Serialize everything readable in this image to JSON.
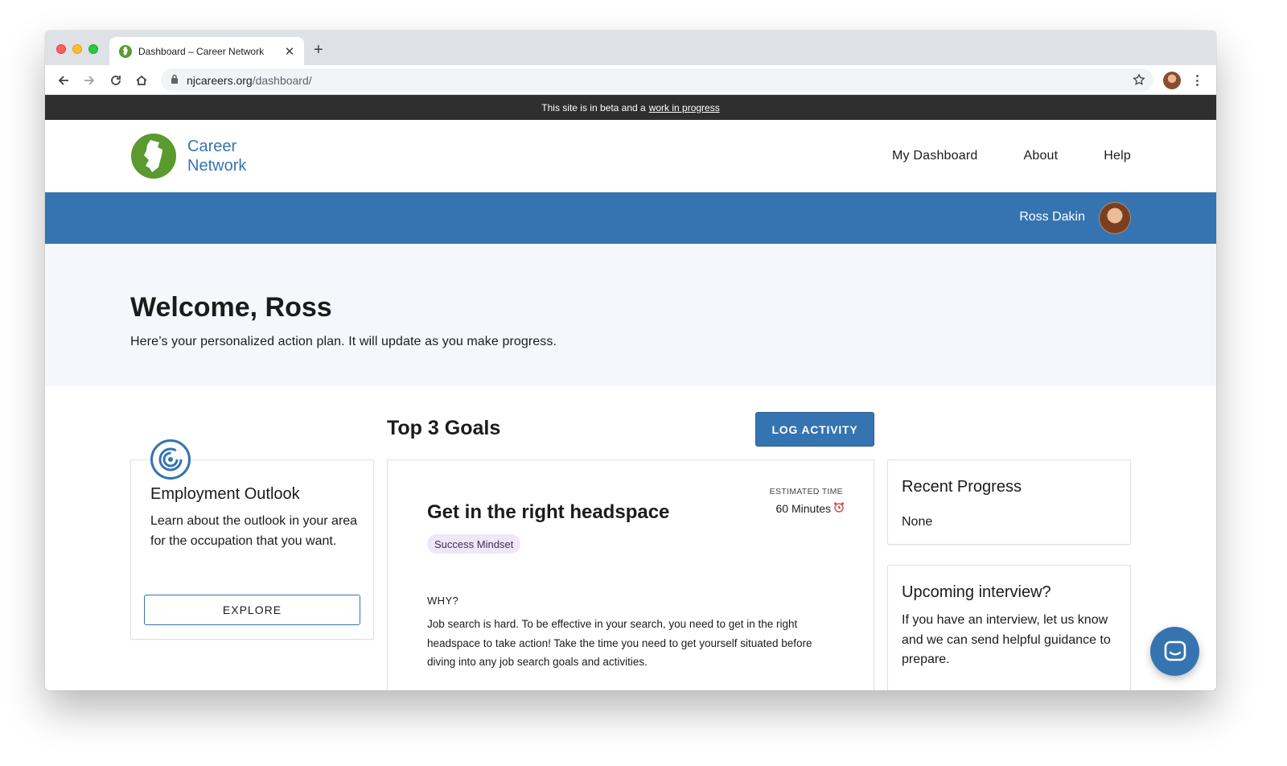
{
  "browser": {
    "tab_title": "Dashboard – Career Network",
    "url_domain": "njcareers.org",
    "url_path": "/dashboard/"
  },
  "beta_banner": {
    "text": "This site is in beta and a",
    "link": "work in progress"
  },
  "header": {
    "logo_line1": "Career",
    "logo_line2": "Network",
    "nav": [
      "My Dashboard",
      "About",
      "Help"
    ]
  },
  "user": {
    "name": "Ross Dakin"
  },
  "hero": {
    "title": "Welcome, Ross",
    "subtitle": "Here’s your personalized action plan. It will update as you make progress."
  },
  "outlook_card": {
    "title": "Employment Outlook",
    "description": "Learn about the outlook in your area for the occupation that you want.",
    "button": "EXPLORE"
  },
  "goals": {
    "heading": "Top 3 Goals",
    "log_button": "LOG ACTIVITY",
    "current": {
      "title": "Get in the right headspace",
      "estimated_label": "ESTIMATED TIME",
      "estimated_value": "60 Minutes",
      "tag": "Success Mindset",
      "why_label": "WHY?",
      "why_text": "Job search is hard. To be effective in your search, you need to get in the right headspace to take action! Take the time you need to get yourself situated before diving into any job search goals and activities."
    }
  },
  "recent_progress": {
    "title": "Recent Progress",
    "value": "None"
  },
  "interview_card": {
    "title": "Upcoming interview?",
    "text": "If you have an interview, let us know and we can send helpful guidance to prepare."
  },
  "colors": {
    "brand_blue": "#3574b1",
    "brand_green": "#5b9a2e",
    "beta_bar": "#2f2f2f",
    "hero_bg": "#f4f8fd",
    "tag_bg": "#efe7f8"
  },
  "icons": [
    "back-icon",
    "forward-icon",
    "reload-icon",
    "home-icon",
    "lock-icon",
    "star-icon",
    "new-jersey-icon",
    "target-icon",
    "alarm-clock-icon",
    "chat-icon"
  ]
}
